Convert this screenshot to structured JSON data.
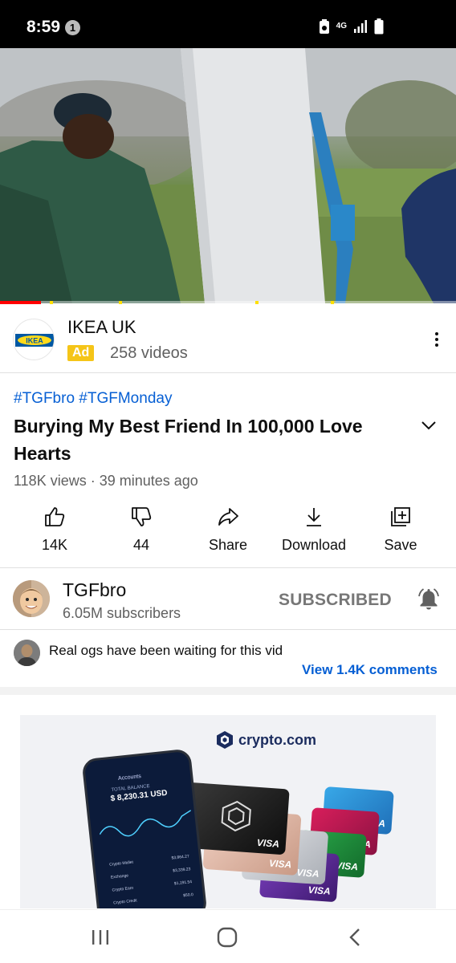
{
  "status_bar": {
    "time": "8:59",
    "notification_count": "1",
    "network": "4G"
  },
  "video": {
    "progress": 0.09
  },
  "ad": {
    "logo_text": "IKEA",
    "title": "IKEA UK",
    "badge": "Ad",
    "video_count": "258 videos"
  },
  "video_info": {
    "hashtags": "#TGFbro #TGFMonday",
    "title": "Burying My Best Friend In 100,000 Love Hearts",
    "meta": "118K views · 39 minutes ago"
  },
  "actions": [
    {
      "label": "14K",
      "icon": "thumbs-up-icon"
    },
    {
      "label": "44",
      "icon": "thumbs-down-icon"
    },
    {
      "label": "Share",
      "icon": "share-icon"
    },
    {
      "label": "Download",
      "icon": "download-icon"
    },
    {
      "label": "Save",
      "icon": "save-icon"
    }
  ],
  "channel": {
    "name": "TGFbro",
    "subscribers": "6.05M subscribers",
    "subscribe_label": "SUBSCRIBED",
    "bell_icon": "bell-icon"
  },
  "comments": {
    "top_comment": "Real ogs have been waiting for this vid",
    "view_label": "View 1.4K comments"
  },
  "banner_ad": {
    "brand": "crypto.com",
    "phone_title": "Accounts",
    "balance_label": "TOTAL BALANCE",
    "balance": "$ 8,230.31 USD",
    "rows": [
      {
        "name": "Crypto Wallet",
        "value": "$3,864.27"
      },
      {
        "name": "Exchange",
        "value": "$3,339.23"
      },
      {
        "name": "Crypto Earn",
        "value": "$1,191.54"
      },
      {
        "name": "Crypto Credit",
        "value": "$50.0"
      }
    ],
    "card_network": "VISA"
  },
  "colors": {
    "accent_blue": "#065fd4",
    "ad_yellow": "#f5c518",
    "progress_red": "#ff0000",
    "ikea_blue": "#0058a3",
    "ikea_yellow": "#ffda1a"
  }
}
